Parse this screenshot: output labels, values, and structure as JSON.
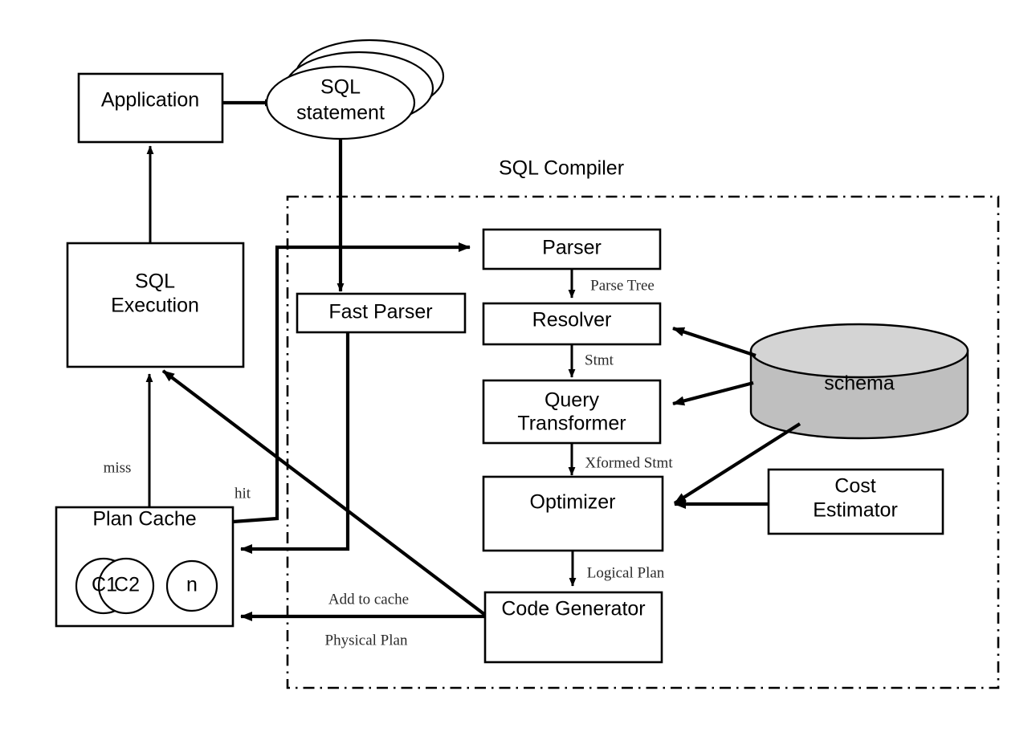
{
  "diagram": {
    "title": "SQL Compiler",
    "nodes": {
      "application": "Application",
      "sql_statement_line1": "SQL",
      "sql_statement_line2": "statement",
      "sql_execution_line1": "SQL",
      "sql_execution_line2": "Execution",
      "plan_cache": "Plan Cache",
      "cache_entry_1": "C1",
      "cache_entry_2": "C2",
      "cache_entry_n": "n",
      "fast_parser": "Fast Parser",
      "parser": "Parser",
      "resolver": "Resolver",
      "query_transformer_line1": "Query",
      "query_transformer_line2": "Transformer",
      "optimizer": "Optimizer",
      "code_generator": "Code Generator",
      "schema": "schema",
      "cost_estimator_line1": "Cost",
      "cost_estimator_line2": "Estimator"
    },
    "edge_labels": {
      "parse_tree": "Parse Tree",
      "stmt": "Stmt",
      "xformed_stmt": "Xformed Stmt",
      "logical_plan": "Logical Plan",
      "miss": "miss",
      "hit": "hit",
      "add_to_cache": "Add to cache",
      "physical_plan": "Physical Plan"
    },
    "colors": {
      "stroke": "#000000",
      "background": "#ffffff",
      "cylinder_body": "#bfbfbf",
      "cylinder_top": "#d4d4d4"
    }
  }
}
